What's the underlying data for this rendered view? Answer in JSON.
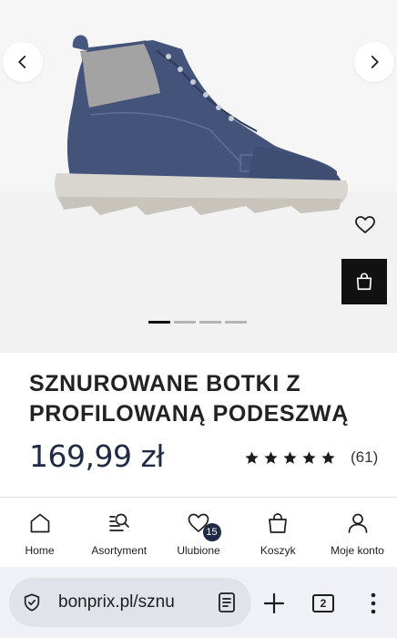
{
  "product": {
    "title": "SZNUROWANE BOTKI Z PROFILOWANĄ PODESZWĄ",
    "price": "169,99 zł",
    "rating_stars": 5,
    "review_count": "(61)",
    "image_alt": "boot",
    "gallery_total": 4,
    "gallery_active": 1
  },
  "gallery": {
    "prev_icon": "chevron-left-icon",
    "next_icon": "chevron-right-icon",
    "wishlist_icon": "heart-icon",
    "cart_icon": "shopping-bag-icon"
  },
  "bottom_nav": {
    "items": [
      {
        "label": "Home",
        "icon": "home-icon"
      },
      {
        "label": "Asortyment",
        "icon": "search-list-icon"
      },
      {
        "label": "Ulubione",
        "icon": "heart-icon",
        "badge": "15"
      },
      {
        "label": "Koszyk",
        "icon": "shopping-bag-icon"
      },
      {
        "label": "Moje konto",
        "icon": "user-icon"
      }
    ]
  },
  "browser": {
    "url": "bonprix.pl/sznu",
    "tab_count": "2",
    "icons": [
      "shield-icon",
      "reader-mode-icon",
      "plus-icon",
      "tabs-icon",
      "more-vertical-icon"
    ]
  },
  "colors": {
    "price_text": "#1f2a44",
    "cart_button": "#111111",
    "badge": "#1f2a44",
    "boot_blue": "#43537a"
  }
}
